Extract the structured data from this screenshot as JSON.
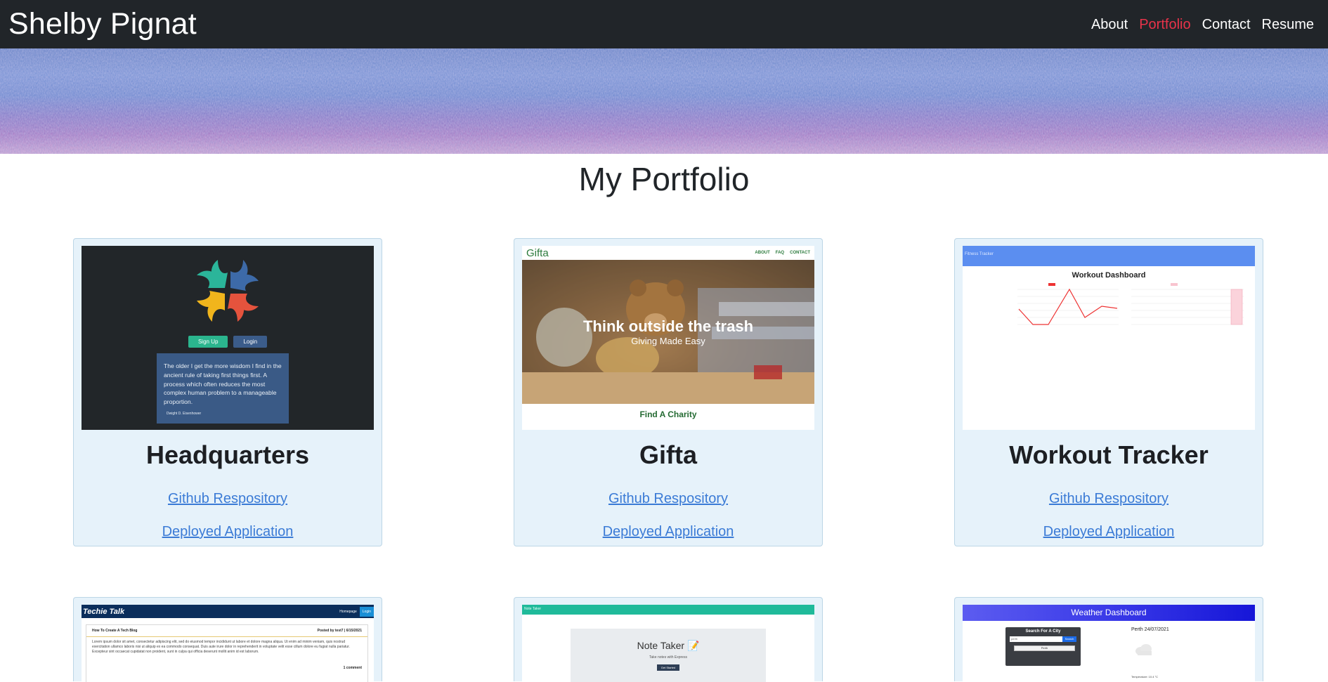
{
  "header": {
    "brand": "Shelby Pignat",
    "nav": [
      {
        "label": "About",
        "active": false
      },
      {
        "label": "Portfolio",
        "active": true
      },
      {
        "label": "Contact",
        "active": false
      },
      {
        "label": "Resume",
        "active": false
      }
    ],
    "active_color": "#e8334a"
  },
  "page_title": "My Portfolio",
  "projects": [
    {
      "title": "Headquarters",
      "github_label": "Github Respository",
      "deployed_label": "Deployed Application",
      "preview": {
        "signup_label": "Sign Up",
        "login_label": "Login",
        "quote": "The older I get the more wisdom I find in the ancient rule of taking first things first. A process which often reduces the most complex human problem to a manageable proportion.",
        "quote_author": "Dwight D. Eisenhower"
      }
    },
    {
      "title": "Gifta",
      "github_label": "Github Respository",
      "deployed_label": "Deployed Application",
      "preview": {
        "logo": "Gifta",
        "nav": [
          "ABOUT",
          "FAQ",
          "CONTACT"
        ],
        "hero_title": "Think outside the trash",
        "hero_subtitle": "Giving Made Easy",
        "cta": "Find A Charity"
      }
    },
    {
      "title": "Workout Tracker",
      "github_label": "Github Respository",
      "deployed_label": "Deployed Application",
      "preview": {
        "app_name": "Fitness Tracker",
        "dashboard_title": "Workout Dashboard"
      }
    },
    {
      "title": "",
      "preview": {
        "logo": "Techie Talk",
        "nav_home": "Homepage",
        "nav_login": "Login",
        "post_title": "How To Create A Tech Blog",
        "post_meta": "Posted by test7 | 6/15/2021",
        "post_body": "Lorem ipsum dolor sit amet, consectetur adipiscing elit, sed do eiusmod tempor incididunt ut labore et dolore magna aliqua. Ut enim ad minim veniam, quis nostrud exercitation ullamco laboris nisi ut aliquip ex ea commodo consequat. Duis aute irure dolor in reprehenderit in voluptate velit esse cillum dolore eu fugiat nulla pariatur. Excepteur sint occaecat cupidatat non proident, sunt in culpa qui officia deserunt mollit anim id est laborum.",
        "comments": "1 comment"
      }
    },
    {
      "title": "",
      "preview": {
        "app_name": "Note Taker",
        "heading": "Note Taker 📝",
        "subheading": "Take notes with Express",
        "button": "Get Started"
      }
    },
    {
      "title": "",
      "preview": {
        "header": "Weather Dashboard",
        "search_title": "Search For A City",
        "search_value": "perth",
        "search_button": "Search",
        "history_item": "Perth",
        "city_date": "Perth 24/07/2021",
        "temperature": "Temperature: 10.4 °C"
      }
    }
  ]
}
